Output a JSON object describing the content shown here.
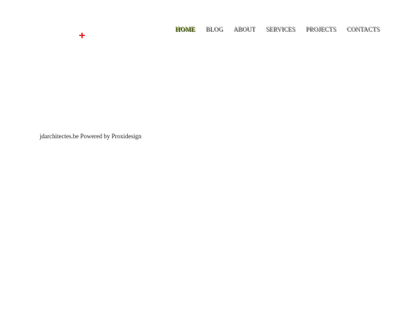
{
  "logo": {
    "glyph": "+",
    "color": "#e41b1b"
  },
  "nav": {
    "items": [
      {
        "label": "HOME",
        "active": true
      },
      {
        "label": "BLOG",
        "active": false
      },
      {
        "label": "ABOUT",
        "active": false
      },
      {
        "label": "SERVICES",
        "active": false
      },
      {
        "label": "PROJECTS",
        "active": false
      },
      {
        "label": "CONTACTS",
        "active": false
      }
    ],
    "active_color": "#7a8d3a",
    "text_color": "#8a8a8a"
  },
  "footer": {
    "text": "jdarchitectes.be Powered by Proxidesign"
  }
}
